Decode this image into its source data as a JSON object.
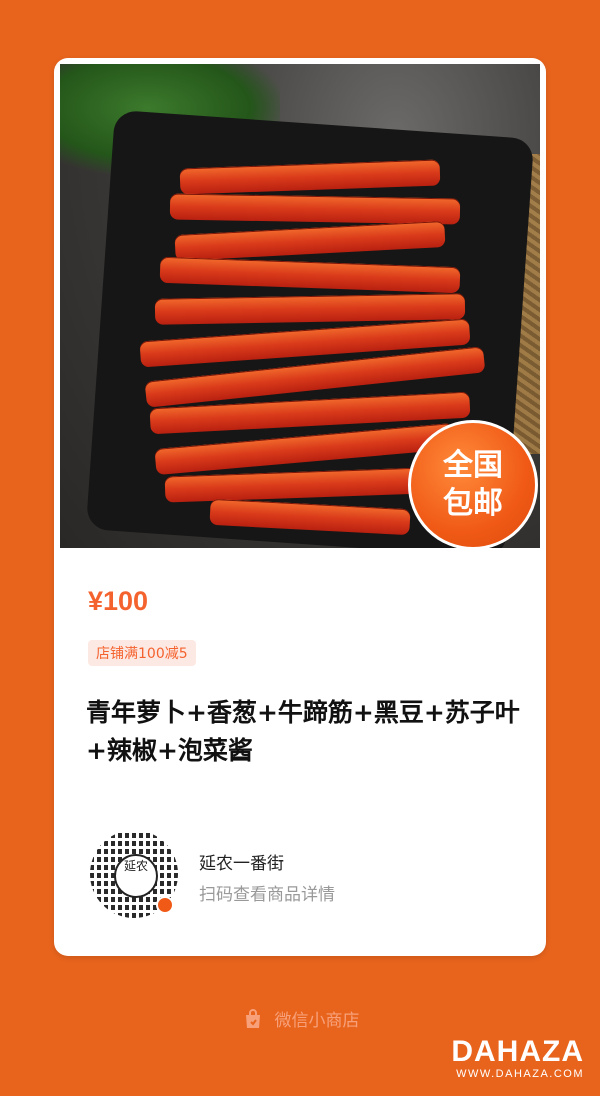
{
  "product": {
    "image_badge": [
      "全国",
      "包邮"
    ],
    "price": "¥100",
    "coupon": "店铺满100减5",
    "title": "青年萝卜+香葱+牛蹄筋+黑豆+苏子叶+辣椒+泡菜酱"
  },
  "shop": {
    "name": "延农一番街",
    "cta": "扫码查看商品详情",
    "qr_center_text": "延农"
  },
  "footer": {
    "label": "微信小商店",
    "icon": "shopping-bag-icon"
  },
  "watermark": {
    "brand": "DAHAZA",
    "url": "WWW.DAHAZA.COM"
  },
  "colors": {
    "background": "#e8641d",
    "accent": "#f4622e",
    "coupon_bg": "#fde9e3"
  }
}
